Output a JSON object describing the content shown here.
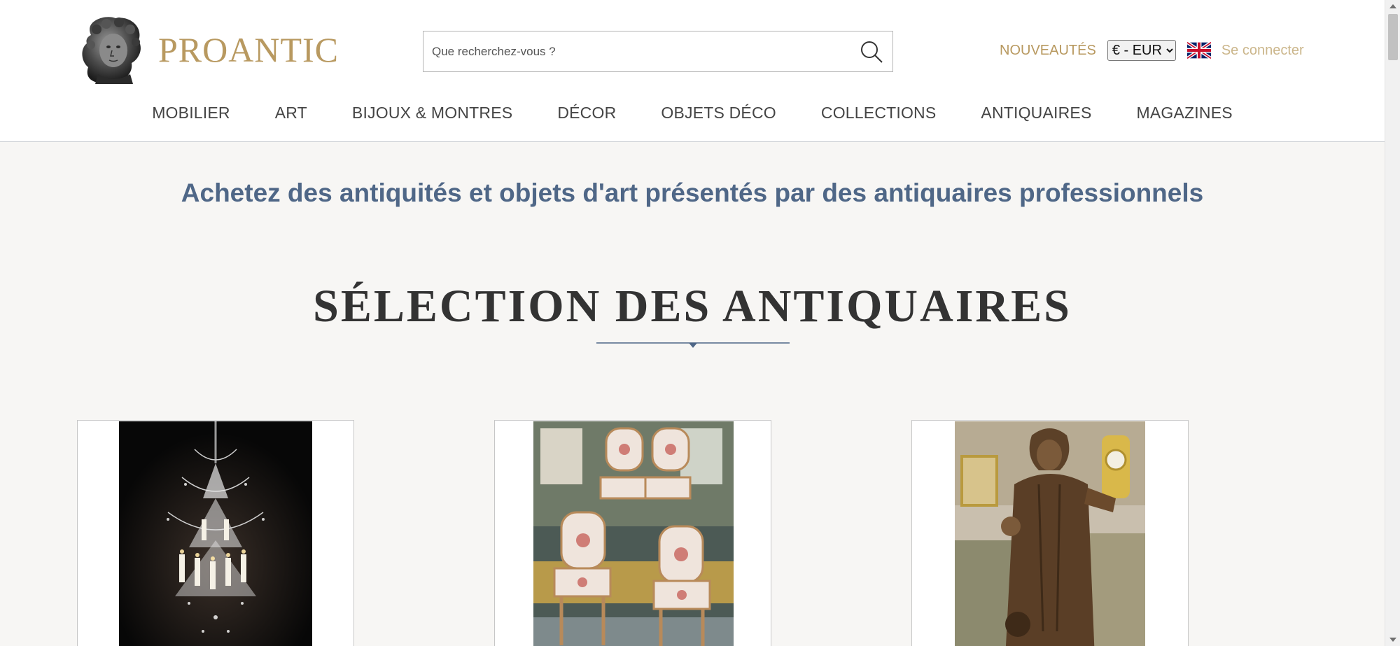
{
  "header": {
    "logo_text": "PROANTIC",
    "search_placeholder": "Que recherchez-vous ?",
    "nouveautes": "NOUVEAUTÉS",
    "currency_selected": "€ - EUR",
    "language_flag": "uk-flag-icon",
    "login": "Se connecter"
  },
  "nav": {
    "items": [
      "MOBILIER",
      "ART",
      "BIJOUX & MONTRES",
      "DÉCOR",
      "OBJETS DÉCO",
      "COLLECTIONS",
      "ANTIQUAIRES",
      "MAGAZINES"
    ]
  },
  "main": {
    "tagline": "Achetez des antiquités et objets d'art présentés par des antiquaires professionnels",
    "section_title": "SÉLECTION DES ANTIQUAIRES"
  },
  "colors": {
    "brand_gold": "#b89960",
    "login_gold": "#cbb68b",
    "tagline_blue": "#4f6787",
    "page_bg": "#f7f6f4"
  },
  "icons": {
    "logo": "bust-logo-icon",
    "search": "search-icon"
  },
  "cards": [
    {
      "image": "crystal-chandelier-photo"
    },
    {
      "image": "louis-xvi-chairs-photo"
    },
    {
      "image": "wooden-saint-statue-photo"
    }
  ]
}
